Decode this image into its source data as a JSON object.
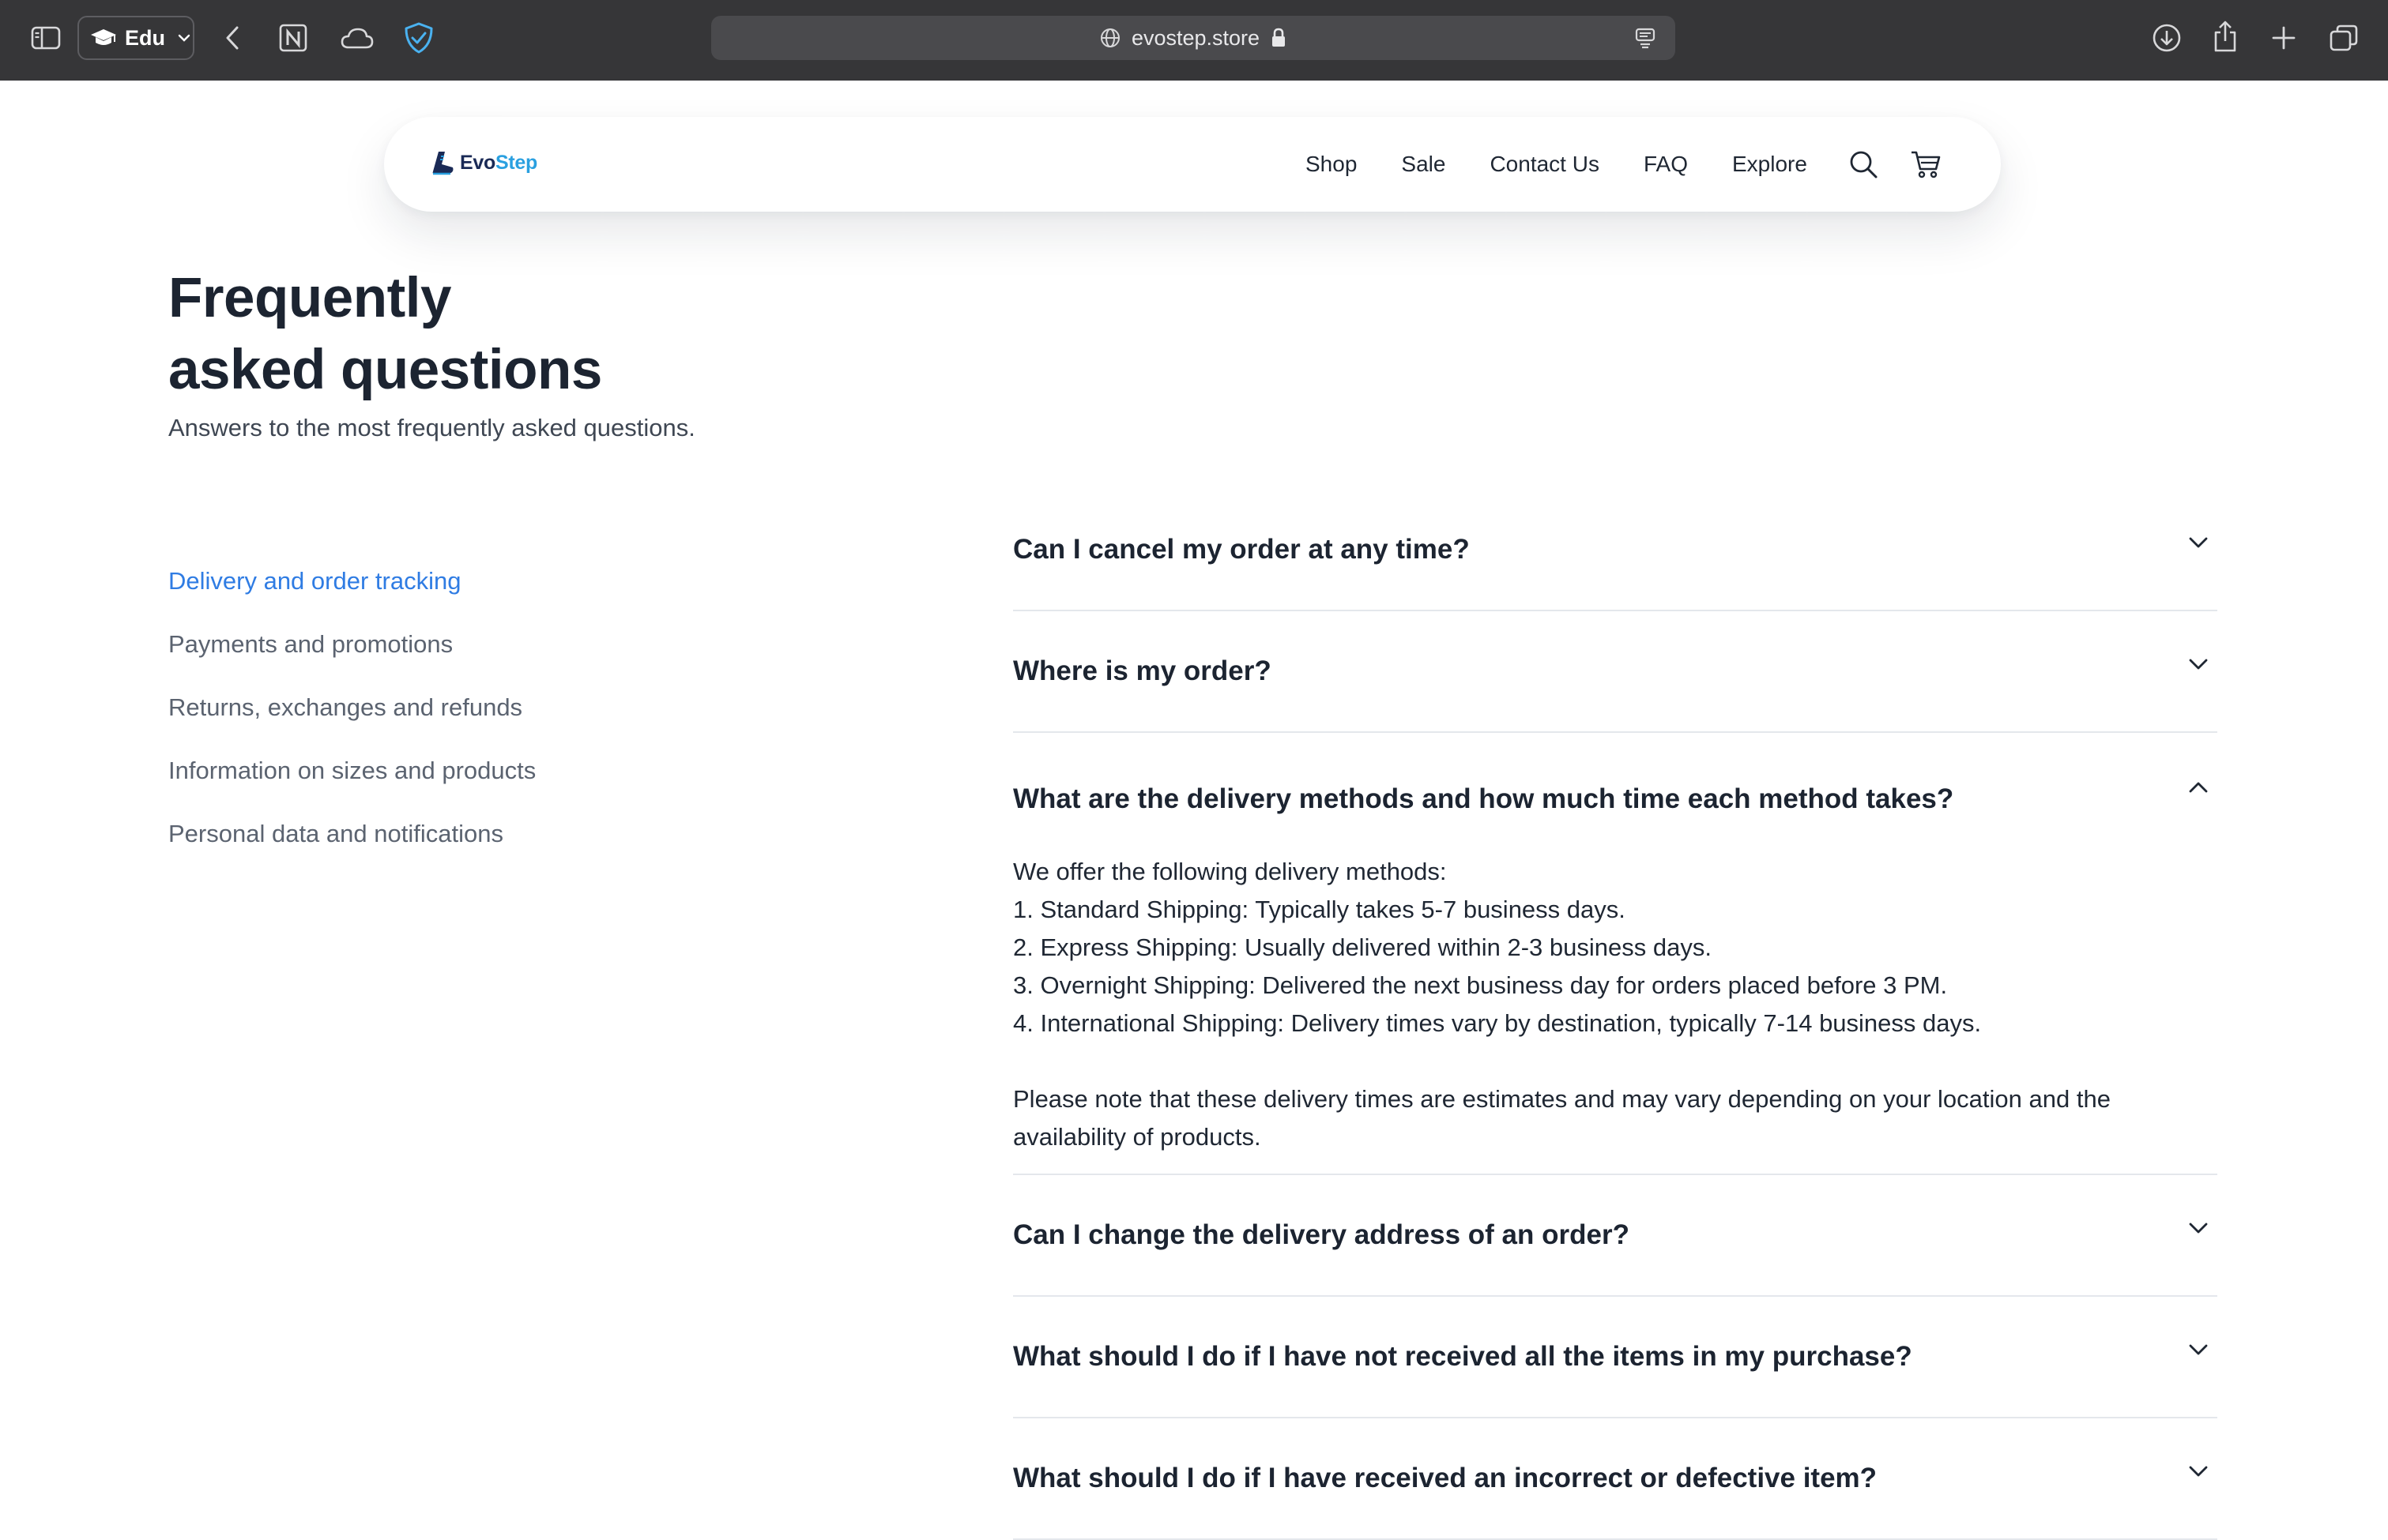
{
  "browser": {
    "profile_label": "Edu",
    "url": "evostep.store"
  },
  "site": {
    "logo": {
      "part1": "Evo",
      "part2": "Step"
    },
    "nav": [
      {
        "label": "Shop"
      },
      {
        "label": "Sale"
      },
      {
        "label": "Contact Us"
      },
      {
        "label": "FAQ"
      },
      {
        "label": "Explore"
      }
    ]
  },
  "page": {
    "title_line1": "Frequently",
    "title_line2": "asked questions",
    "subtitle": "Answers to the most frequently asked questions."
  },
  "categories": [
    {
      "label": "Delivery and order tracking",
      "active": true
    },
    {
      "label": "Payments and promotions",
      "active": false
    },
    {
      "label": "Returns, exchanges and refunds",
      "active": false
    },
    {
      "label": "Information on sizes and products",
      "active": false
    },
    {
      "label": "Personal data and notifications",
      "active": false
    }
  ],
  "faq": [
    {
      "question": "Can I cancel my order at any time?",
      "open": false
    },
    {
      "question": "Where is my order?",
      "open": false
    },
    {
      "question": "What are the delivery methods and how much time each method takes?",
      "open": true,
      "answer": {
        "intro": "We offer the following delivery methods:",
        "items": [
          "1. Standard Shipping: Typically takes 5-7 business days.",
          "2. Express Shipping: Usually delivered within 2-3 business days.",
          "3. Overnight Shipping: Delivered the next business day for orders placed before 3 PM.",
          "4. International Shipping: Delivery times vary by destination, typically 7-14 business days."
        ],
        "note": "Please note that these delivery times are estimates and may vary depending on your location and the availability of products."
      }
    },
    {
      "question": "Can I change the delivery address of an order?",
      "open": false
    },
    {
      "question": "What should I do if I have not received all the items in my purchase?",
      "open": false
    },
    {
      "question": "What should I do if I have received an incorrect or defective item?",
      "open": false
    }
  ],
  "colors": {
    "accent": "#2f7ce3",
    "chrome_bg": "#363638",
    "logo_dark": "#1a2a56",
    "logo_light": "#2aa0e0"
  },
  "icons": {
    "browser": [
      "sidebar-icon",
      "graduation-cap-icon",
      "back-icon",
      "notion-icon",
      "cloud-icon",
      "shield-check-icon",
      "globe-icon",
      "lock-icon",
      "reader-icon",
      "download-icon",
      "share-icon",
      "new-tab-icon",
      "tabs-overview-icon"
    ],
    "site": [
      "logo-shoe-icon",
      "search-icon",
      "cart-icon",
      "chevron-down-icon",
      "chevron-up-icon"
    ]
  }
}
